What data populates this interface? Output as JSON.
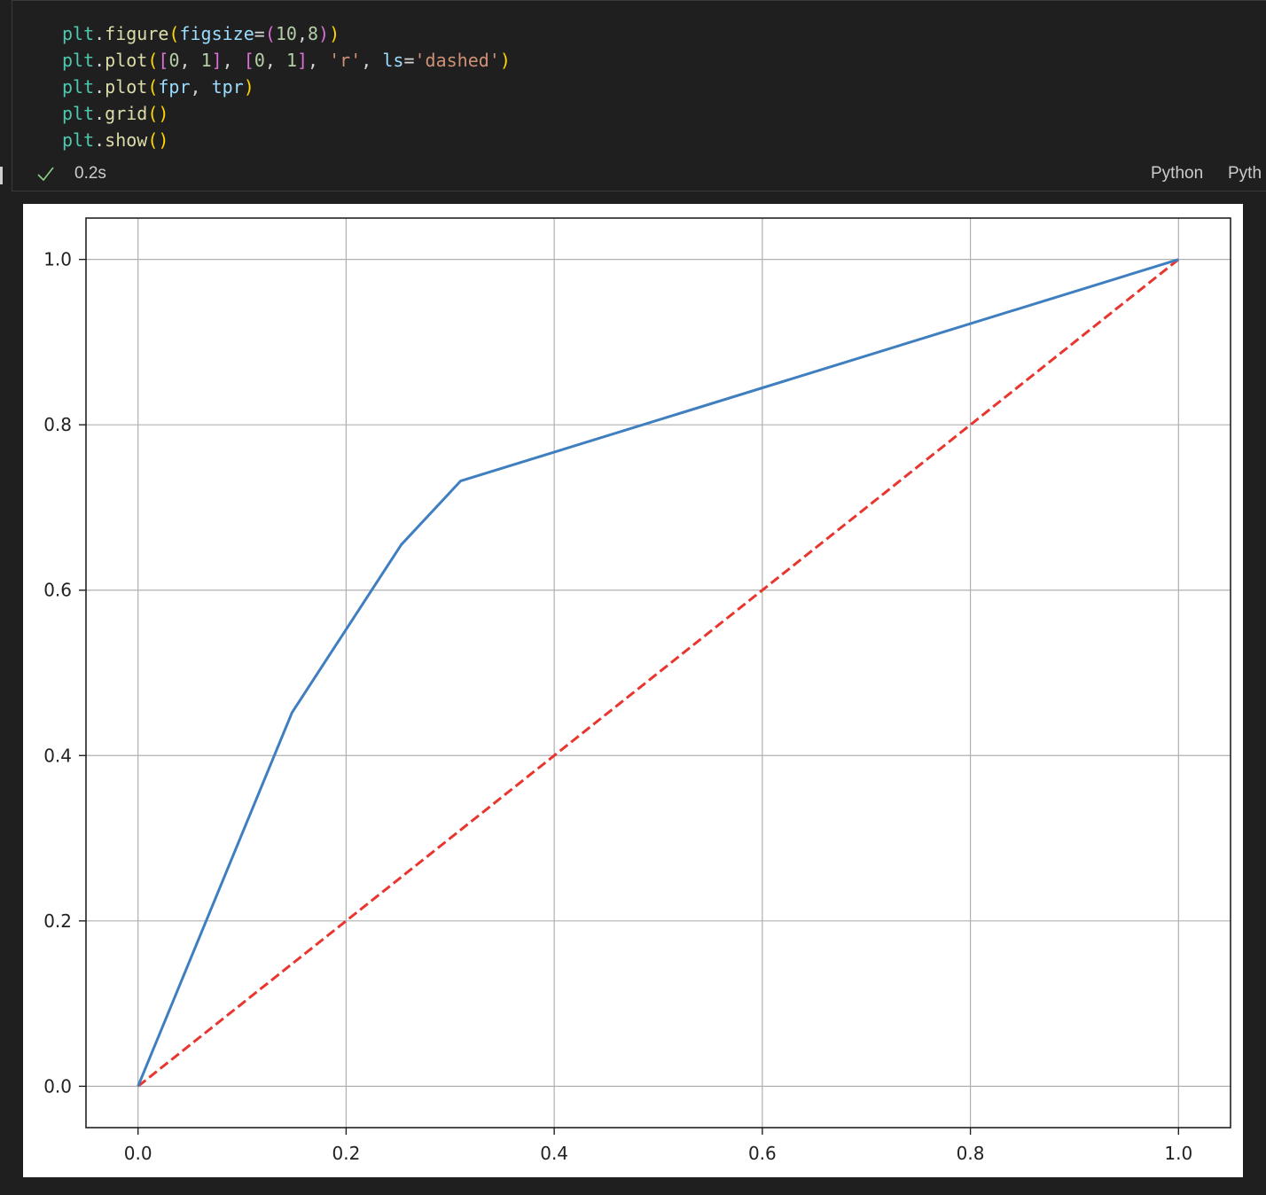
{
  "cell": {
    "code_lines": [
      [
        {
          "t": "plt",
          "c": "#4ec9b0"
        },
        {
          "t": ".",
          "c": "#d4d4d4"
        },
        {
          "t": "figure",
          "c": "#dcdcaa"
        },
        {
          "t": "(",
          "c": "#ffd700"
        },
        {
          "t": "figsize",
          "c": "#9cdcfe"
        },
        {
          "t": "=",
          "c": "#d4d4d4"
        },
        {
          "t": "(",
          "c": "#da70d6"
        },
        {
          "t": "10",
          "c": "#b5cea8"
        },
        {
          "t": ",",
          "c": "#d4d4d4"
        },
        {
          "t": "8",
          "c": "#b5cea8"
        },
        {
          "t": ")",
          "c": "#da70d6"
        },
        {
          "t": ")",
          "c": "#ffd700"
        }
      ],
      [
        {
          "t": "plt",
          "c": "#4ec9b0"
        },
        {
          "t": ".",
          "c": "#d4d4d4"
        },
        {
          "t": "plot",
          "c": "#dcdcaa"
        },
        {
          "t": "(",
          "c": "#ffd700"
        },
        {
          "t": "[",
          "c": "#da70d6"
        },
        {
          "t": "0",
          "c": "#b5cea8"
        },
        {
          "t": ", ",
          "c": "#d4d4d4"
        },
        {
          "t": "1",
          "c": "#b5cea8"
        },
        {
          "t": "]",
          "c": "#da70d6"
        },
        {
          "t": ", ",
          "c": "#d4d4d4"
        },
        {
          "t": "[",
          "c": "#da70d6"
        },
        {
          "t": "0",
          "c": "#b5cea8"
        },
        {
          "t": ", ",
          "c": "#d4d4d4"
        },
        {
          "t": "1",
          "c": "#b5cea8"
        },
        {
          "t": "]",
          "c": "#da70d6"
        },
        {
          "t": ", ",
          "c": "#d4d4d4"
        },
        {
          "t": "'r'",
          "c": "#ce9178"
        },
        {
          "t": ", ",
          "c": "#d4d4d4"
        },
        {
          "t": "ls",
          "c": "#9cdcfe"
        },
        {
          "t": "=",
          "c": "#d4d4d4"
        },
        {
          "t": "'dashed'",
          "c": "#ce9178"
        },
        {
          "t": ")",
          "c": "#ffd700"
        }
      ],
      [
        {
          "t": "plt",
          "c": "#4ec9b0"
        },
        {
          "t": ".",
          "c": "#d4d4d4"
        },
        {
          "t": "plot",
          "c": "#dcdcaa"
        },
        {
          "t": "(",
          "c": "#ffd700"
        },
        {
          "t": "fpr",
          "c": "#9cdcfe"
        },
        {
          "t": ", ",
          "c": "#d4d4d4"
        },
        {
          "t": "tpr",
          "c": "#9cdcfe"
        },
        {
          "t": ")",
          "c": "#ffd700"
        }
      ],
      [
        {
          "t": "plt",
          "c": "#4ec9b0"
        },
        {
          "t": ".",
          "c": "#d4d4d4"
        },
        {
          "t": "grid",
          "c": "#dcdcaa"
        },
        {
          "t": "()",
          "c": "#ffd700"
        }
      ],
      [
        {
          "t": "plt",
          "c": "#4ec9b0"
        },
        {
          "t": ".",
          "c": "#d4d4d4"
        },
        {
          "t": "show",
          "c": "#dcdcaa"
        },
        {
          "t": "()",
          "c": "#ffd700"
        }
      ]
    ],
    "exec_time": "0.2s",
    "kernel_label": "Python",
    "kernel_label_2": "Pyth",
    "check_color": "#89d185"
  },
  "chart_data": {
    "type": "line",
    "title": "",
    "xlabel": "",
    "ylabel": "",
    "xlim": [
      -0.05,
      1.05
    ],
    "ylim": [
      -0.05,
      1.05
    ],
    "xticks": [
      "0.0",
      "0.2",
      "0.4",
      "0.6",
      "0.8",
      "1.0"
    ],
    "yticks": [
      "0.0",
      "0.2",
      "0.4",
      "0.6",
      "0.8",
      "1.0"
    ],
    "grid": true,
    "series": [
      {
        "color": "#e8362f",
        "style": "dashed",
        "x": [
          0,
          1
        ],
        "y": [
          0,
          1
        ]
      },
      {
        "color": "#3f7fbf",
        "style": "solid",
        "x": [
          0,
          0.148,
          0.253,
          0.31,
          1
        ],
        "y": [
          0,
          0.452,
          0.655,
          0.732,
          1
        ]
      }
    ]
  }
}
